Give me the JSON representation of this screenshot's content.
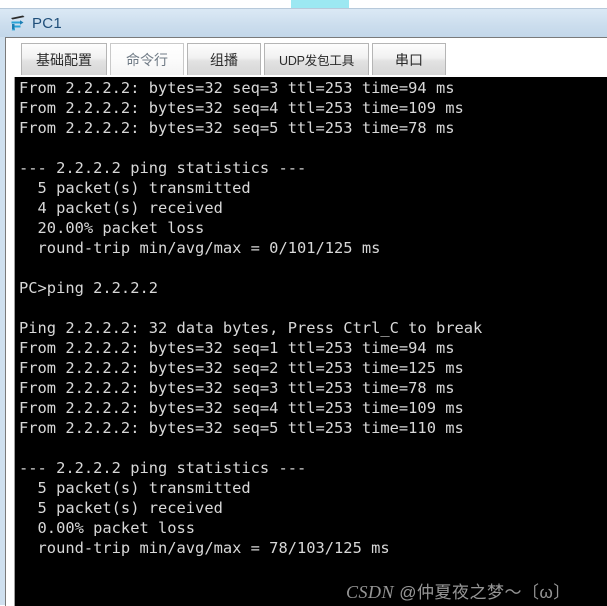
{
  "top_fragment": {
    "text": ""
  },
  "window": {
    "title": "PC1",
    "icon": "router-device-icon"
  },
  "tabs": [
    {
      "label": "基础配置",
      "name": "tab-basic-config",
      "active": false
    },
    {
      "label": "命令行",
      "name": "tab-command-line",
      "active": true
    },
    {
      "label": "组播",
      "name": "tab-multicast",
      "active": false
    },
    {
      "label": "UDP发包工具",
      "name": "tab-udp-tool",
      "active": false
    },
    {
      "label": "串口",
      "name": "tab-serial-port",
      "active": false
    }
  ],
  "terminal": {
    "background_color": "#000000",
    "text_color": "#d8d8d8",
    "lines": [
      "From 2.2.2.2: bytes=32 seq=3 ttl=253 time=94 ms",
      "From 2.2.2.2: bytes=32 seq=4 ttl=253 time=109 ms",
      "From 2.2.2.2: bytes=32 seq=5 ttl=253 time=78 ms",
      "",
      "--- 2.2.2.2 ping statistics ---",
      "  5 packet(s) transmitted",
      "  4 packet(s) received",
      "  20.00% packet loss",
      "  round-trip min/avg/max = 0/101/125 ms",
      "",
      "PC>ping 2.2.2.2",
      "",
      "Ping 2.2.2.2: 32 data bytes, Press Ctrl_C to break",
      "From 2.2.2.2: bytes=32 seq=1 ttl=253 time=94 ms",
      "From 2.2.2.2: bytes=32 seq=2 ttl=253 time=125 ms",
      "From 2.2.2.2: bytes=32 seq=3 ttl=253 time=78 ms",
      "From 2.2.2.2: bytes=32 seq=4 ttl=253 time=109 ms",
      "From 2.2.2.2: bytes=32 seq=5 ttl=253 time=110 ms",
      "",
      "--- 2.2.2.2 ping statistics ---",
      "  5 packet(s) transmitted",
      "  5 packet(s) received",
      "  0.00% packet loss",
      "  round-trip min/avg/max = 78/103/125 ms"
    ]
  },
  "watermark": {
    "brand": "CSDN",
    "text": " @仲夏夜之梦～〔ω〕"
  }
}
